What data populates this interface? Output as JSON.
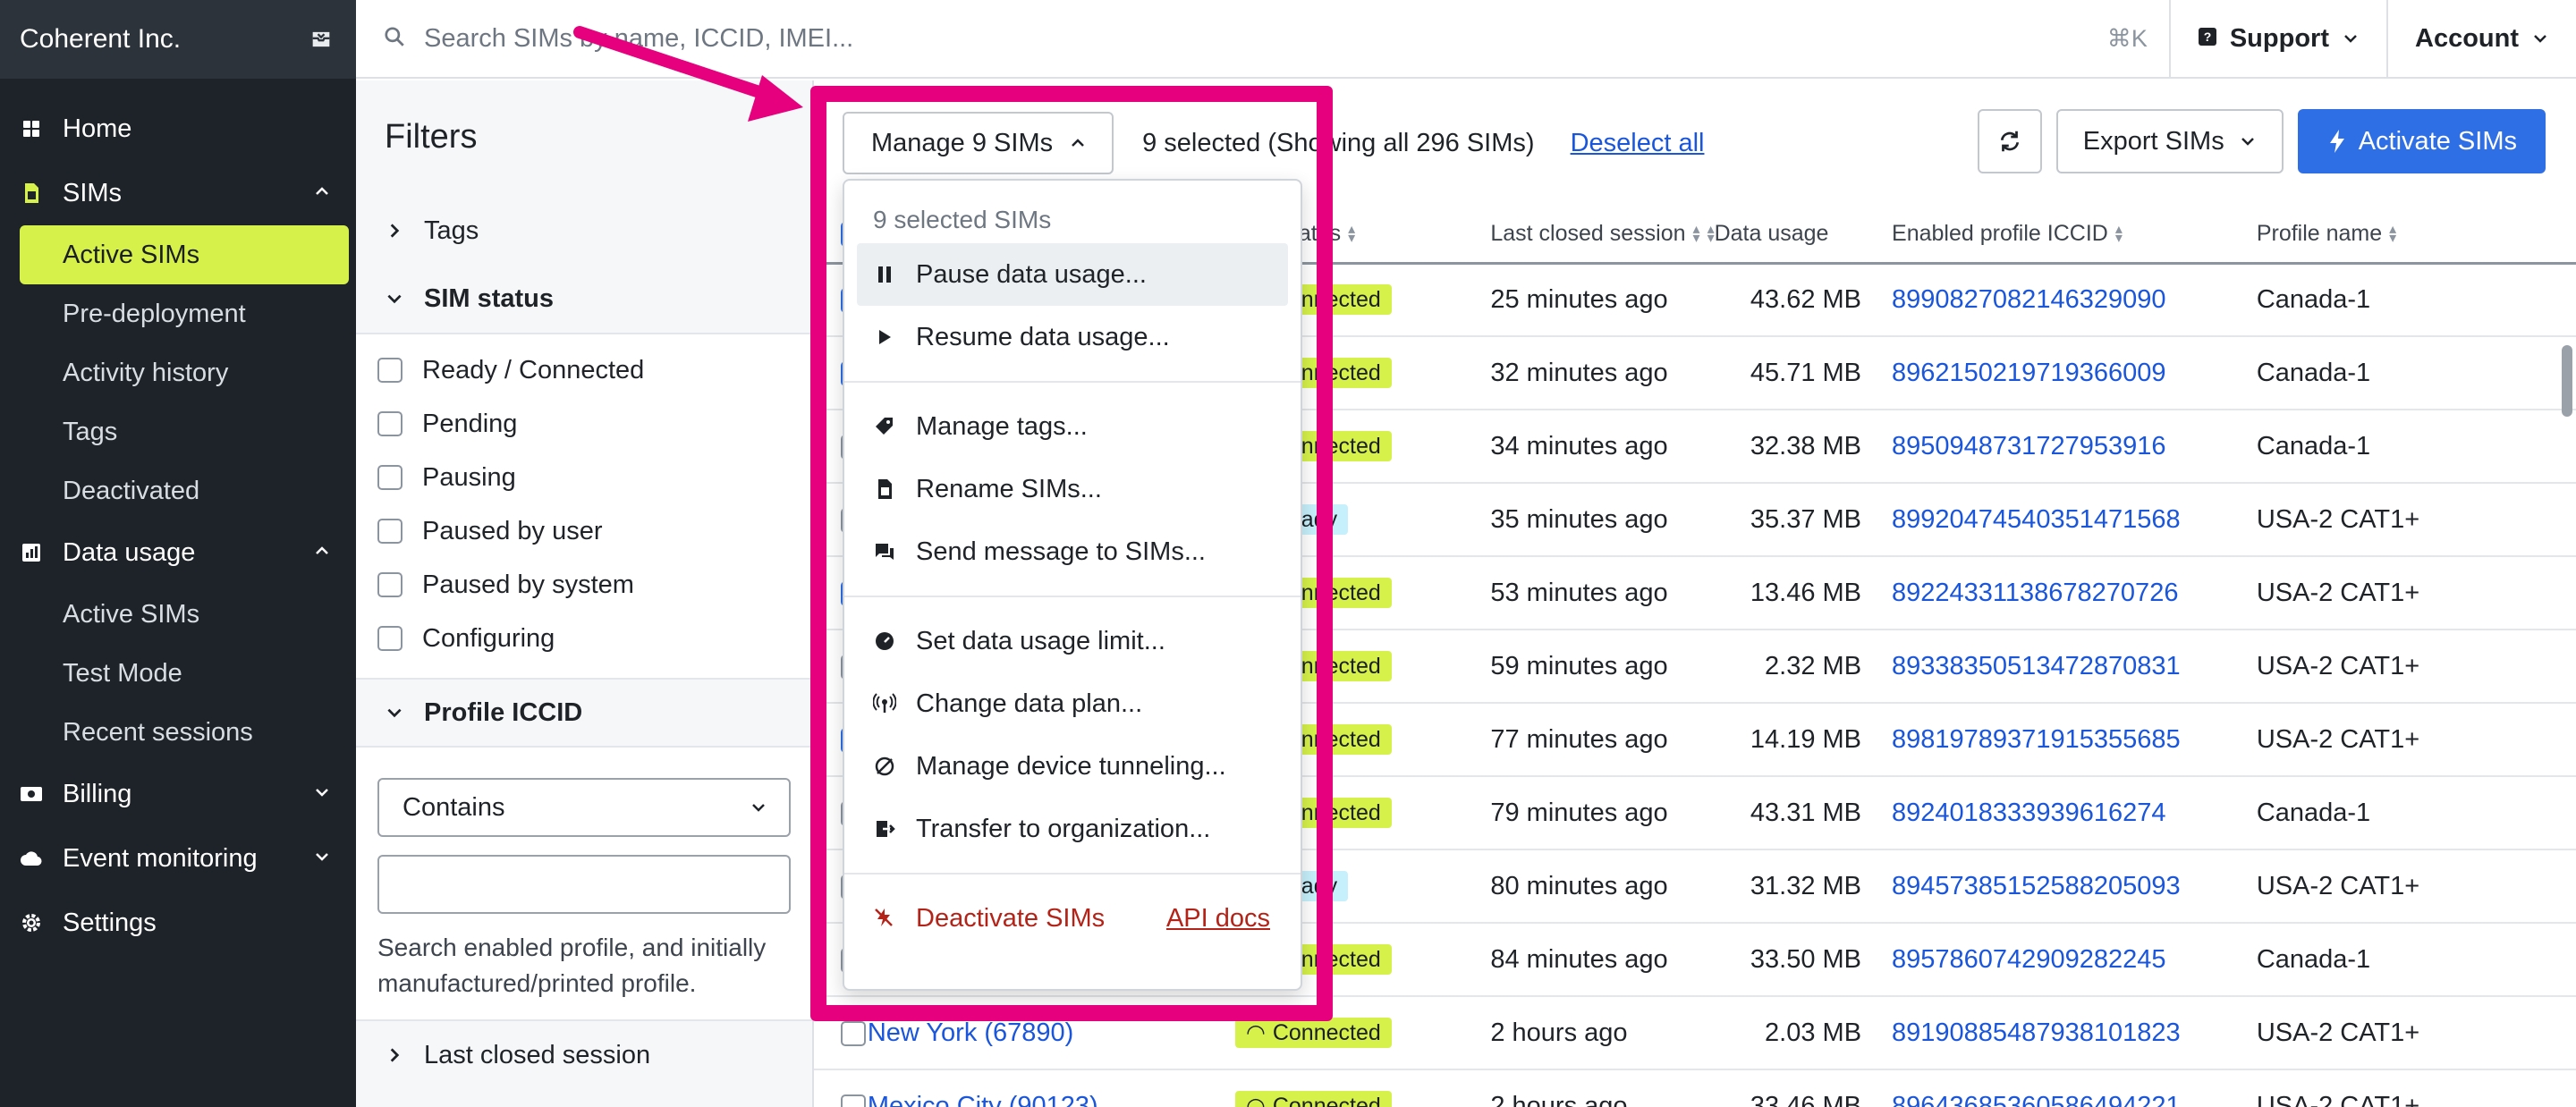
{
  "sidebar": {
    "org_name": "Coherent Inc.",
    "items": [
      {
        "label": "Home",
        "icon": "grid-icon"
      },
      {
        "label": "SIMs",
        "icon": "sim-icon",
        "expanded": true,
        "children": [
          "Active SIMs",
          "Pre-deployment",
          "Activity history",
          "Tags",
          "Deactivated"
        ]
      },
      {
        "label": "Data usage",
        "icon": "chart-icon",
        "expanded": true,
        "children": [
          "Active SIMs",
          "Test Mode",
          "Recent sessions"
        ]
      },
      {
        "label": "Billing",
        "icon": "billing-icon",
        "expanded": false
      },
      {
        "label": "Event monitoring",
        "icon": "cloud-icon",
        "expanded": false
      },
      {
        "label": "Settings",
        "icon": "gear-icon"
      }
    ],
    "active_item": "Active SIMs"
  },
  "topbar": {
    "search_placeholder": "Search SIMs by name, ICCID, IMEI...",
    "shortcut": "⌘K",
    "support_label": "Support",
    "account_label": "Account"
  },
  "filters": {
    "title": "Filters",
    "tags_label": "Tags",
    "sim_status_label": "SIM status",
    "status_options": [
      "Ready / Connected",
      "Pending",
      "Pausing",
      "Paused by user",
      "Paused by system",
      "Configuring"
    ],
    "profile_iccid_label": "Profile ICCID",
    "match_mode": "Contains",
    "iccid_value": "",
    "help_text": "Search enabled profile, and initially manufactured/printed profile.",
    "last_session_label": "Last closed session"
  },
  "toolbar": {
    "manage_label": "Manage 9 SIMs",
    "selection_text": "9 selected (Showing all 296 SIMs)",
    "deselect_label": "Deselect all",
    "export_label": "Export SIMs",
    "activate_label": "Activate SIMs"
  },
  "table": {
    "columns": {
      "status": "SIM status",
      "last_session": "Last closed session",
      "data_usage": "Data usage",
      "iccid": "Enabled profile ICCID",
      "profile": "Profile name"
    },
    "rows": [
      {
        "checked": true,
        "name": "",
        "status": "Connected",
        "last": "25 minutes ago",
        "usage": "43.62 MB",
        "iccid": "8990827082146329090",
        "profile": "Canada-1"
      },
      {
        "checked": true,
        "name": "",
        "status": "Connected",
        "last": "32 minutes ago",
        "usage": "45.71 MB",
        "iccid": "8962150219719366009",
        "profile": "Canada-1"
      },
      {
        "checked": false,
        "name": "",
        "status": "Connected",
        "last": "34 minutes ago",
        "usage": "32.38 MB",
        "iccid": "8950948731727953916",
        "profile": "Canada-1"
      },
      {
        "checked": false,
        "name": "",
        "status": "Ready",
        "last": "35 minutes ago",
        "usage": "35.37 MB",
        "iccid": "89920474540351471568",
        "profile": "USA-2 CAT1+"
      },
      {
        "checked": true,
        "name": "",
        "status": "Connected",
        "last": "53 minutes ago",
        "usage": "13.46 MB",
        "iccid": "89224331138678270726",
        "profile": "USA-2 CAT1+"
      },
      {
        "checked": false,
        "name": "",
        "status": "Connected",
        "last": "59 minutes ago",
        "usage": "2.32 MB",
        "iccid": "89338350513472870831",
        "profile": "USA-2 CAT1+"
      },
      {
        "checked": true,
        "name": "",
        "status": "Connected",
        "last": "77 minutes ago",
        "usage": "14.19 MB",
        "iccid": "89819789371915355685",
        "profile": "USA-2 CAT1+"
      },
      {
        "checked": false,
        "name": "",
        "status": "Connected",
        "last": "79 minutes ago",
        "usage": "43.31 MB",
        "iccid": "8924018333939616274",
        "profile": "Canada-1"
      },
      {
        "checked": false,
        "name": "",
        "status": "Ready",
        "last": "80 minutes ago",
        "usage": "31.32 MB",
        "iccid": "89457385152588205093",
        "profile": "USA-2 CAT1+"
      },
      {
        "checked": false,
        "name": "",
        "status": "Connected",
        "last": "84 minutes ago",
        "usage": "33.50 MB",
        "iccid": "8957860742909282245",
        "profile": "Canada-1"
      },
      {
        "checked": false,
        "name": "New York (67890)",
        "status": "Connected",
        "last": "2 hours ago",
        "usage": "2.03 MB",
        "iccid": "89190885487938101823",
        "profile": "USA-2 CAT1+"
      },
      {
        "checked": false,
        "name": "Mexico City (90123)",
        "status": "Connected",
        "last": "2 hours ago",
        "usage": "33.46 MB",
        "iccid": "89643685360586494221",
        "profile": "USA-2 CAT1+"
      }
    ]
  },
  "menu": {
    "header": "9 selected SIMs",
    "groups": [
      [
        {
          "label": "Pause data usage...",
          "icon": "pause-icon",
          "hover": true
        },
        {
          "label": "Resume data usage...",
          "icon": "play-icon"
        }
      ],
      [
        {
          "label": "Manage tags...",
          "icon": "tag-icon"
        },
        {
          "label": "Rename SIMs...",
          "icon": "sim-card-icon"
        },
        {
          "label": "Send message to SIMs...",
          "icon": "message-icon"
        }
      ],
      [
        {
          "label": "Set data usage limit...",
          "icon": "gauge-icon"
        },
        {
          "label": "Change data plan...",
          "icon": "antenna-icon"
        },
        {
          "label": "Manage device tunneling...",
          "icon": "tunnel-icon"
        },
        {
          "label": "Transfer to organization...",
          "icon": "transfer-icon"
        }
      ]
    ],
    "deactivate_label": "Deactivate SIMs",
    "api_docs_label": "API docs"
  },
  "colors": {
    "sidebar_bg": "#1e2329",
    "accent_lime": "#d6f24a",
    "primary_blue": "#2f6fe6",
    "annotation_pink": "#e6007e",
    "danger_red": "#b42318"
  }
}
